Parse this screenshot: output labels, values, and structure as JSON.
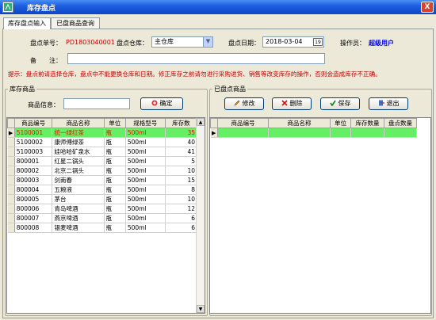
{
  "window": {
    "title": "库存盘点",
    "close_glyph": "X"
  },
  "tabs": [
    {
      "label": "库存盘点输入",
      "active": true
    },
    {
      "label": "已盘商品查询",
      "active": false
    }
  ],
  "header": {
    "doc_no_label": "盘点单号：",
    "doc_no_value": "PD1803040001",
    "warehouse_label": "盘点仓库：",
    "warehouse_value": "主仓库",
    "date_label": "盘点日期：",
    "date_value": "2018-03-04",
    "operator_label": "操作员：",
    "operator_value": "超级用户",
    "remark_label": "备　　注：",
    "remark_value": ""
  },
  "hint": "提示：盘点前请选择仓库，盘点中不能更换仓库和日期。修正库存之前请勿进行采购进货、销售等改变库存的操作，否则会造成库存不正确。",
  "stock_panel": {
    "title": "库存商品",
    "search_label": "商品信息：",
    "search_value": "",
    "confirm_button": "确定",
    "columns": [
      "商品编号",
      "商品名称",
      "单位",
      "规格型号",
      "库存数"
    ],
    "rows": [
      [
        "5100001",
        "统一绿红茶",
        "瓶",
        "500ml",
        "35"
      ],
      [
        "5100002",
        "康师傅绿茶",
        "瓶",
        "500ml",
        "40"
      ],
      [
        "5100003",
        "娃哈哈矿泉水",
        "瓶",
        "500ml",
        "41"
      ],
      [
        "800001",
        "红星二锅头",
        "瓶",
        "500ml",
        "5"
      ],
      [
        "800002",
        "北京二锅头",
        "瓶",
        "500ml",
        "10"
      ],
      [
        "800003",
        "剑南春",
        "瓶",
        "500ml",
        "15"
      ],
      [
        "800004",
        "五粮液",
        "瓶",
        "500ml",
        "8"
      ],
      [
        "800005",
        "茅台",
        "瓶",
        "500ml",
        "10"
      ],
      [
        "800006",
        "青岛啤酒",
        "瓶",
        "500ml",
        "12"
      ],
      [
        "800007",
        "燕京啤酒",
        "瓶",
        "500ml",
        "6"
      ],
      [
        "800008",
        "银麦啤酒",
        "瓶",
        "500ml",
        "6"
      ]
    ],
    "selected_index": 0,
    "row_indicator": "▶"
  },
  "counted_panel": {
    "title": "已盘点商品",
    "buttons": {
      "edit": "修改",
      "delete": "删除",
      "save": "保存",
      "exit": "退出"
    },
    "columns": [
      "商品编号",
      "商品名称",
      "单位",
      "库存数量",
      "盘点数量"
    ],
    "row_indicator": "▶"
  },
  "icons": {
    "app": "app-icon",
    "close": "close-icon",
    "dropdown": "chevron-down-icon",
    "calendar": "calendar-icon",
    "confirm": "confirm-icon",
    "edit": "pencil-icon",
    "delete": "delete-x-icon",
    "save": "checkmark-icon",
    "exit": "exit-door-icon"
  },
  "colors": {
    "titlebar": "#1f5fe0",
    "selected_row": "#66ee66",
    "hint_text": "#c00000",
    "operator_text": "#0000ff"
  }
}
